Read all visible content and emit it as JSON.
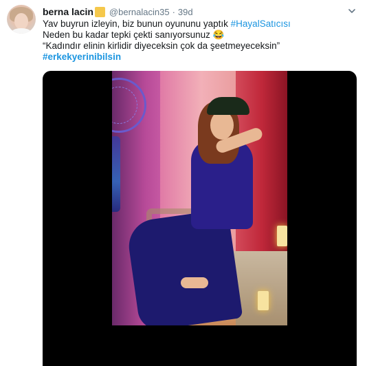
{
  "tweet": {
    "display_name": "berna lacin",
    "handle": "@bernalacin35",
    "separator": "·",
    "time": "39d",
    "text": {
      "line1_prefix": "Yav buyrun izleyin, biz bunun oyununu yaptık ",
      "line1_link": "#HayalSatıcısı",
      "line2": "Neden bu kadar tepki çekti sanıyorsunuz 😂",
      "line3": "“Kadındır elinin kirlidir diyeceksin çok da şeetmeyeceksin”",
      "line4_tag": "#erkekyerinibilsin"
    }
  },
  "colors": {
    "link": "#1b95e0",
    "text": "#14171a",
    "secondary": "#657786",
    "badge": "#f5c84b"
  },
  "icons": {
    "caret": "chevron-down-icon",
    "verified_like": "badge-icon"
  }
}
